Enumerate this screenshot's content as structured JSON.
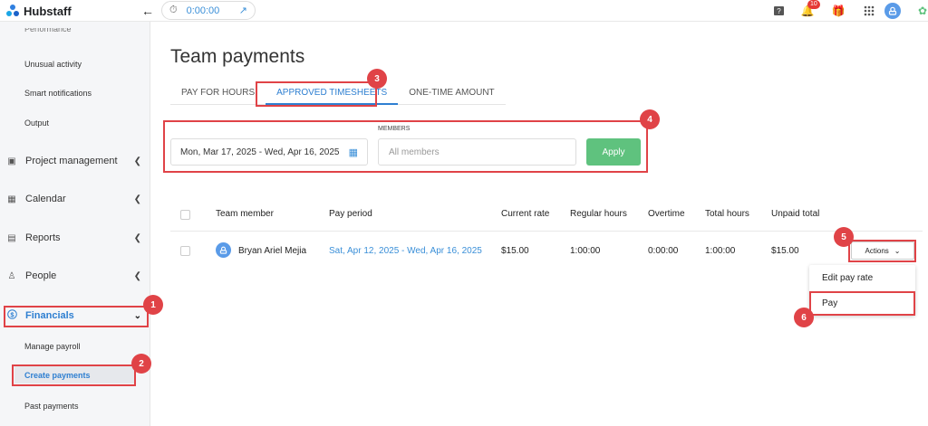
{
  "app": {
    "name": "Hubstaff",
    "timer": "0:00:00",
    "notification_count": "10"
  },
  "sidebar": {
    "partial_item": "Performance",
    "sub_items_top": [
      "Unusual activity",
      "Smart notifications",
      "Output"
    ],
    "main_items": [
      {
        "label": "Project management",
        "icon": "project-icon"
      },
      {
        "label": "Calendar",
        "icon": "calendar-icon"
      },
      {
        "label": "Reports",
        "icon": "reports-icon"
      },
      {
        "label": "People",
        "icon": "people-icon"
      },
      {
        "label": "Financials",
        "icon": "dollar-icon"
      }
    ],
    "financials_sub": [
      "Manage payroll",
      "Create payments",
      "Past payments"
    ]
  },
  "page": {
    "title": "Team payments",
    "tabs": [
      "PAY FOR HOURS",
      "APPROVED TIMESHEETS",
      "ONE-TIME AMOUNT"
    ],
    "active_tab": "APPROVED TIMESHEETS"
  },
  "filters": {
    "date_range": "Mon, Mar 17, 2025 - Wed, Apr 16, 2025",
    "members_label": "MEMBERS",
    "members_placeholder": "All members",
    "apply_label": "Apply"
  },
  "table": {
    "columns": [
      "Team member",
      "Pay period",
      "Current rate",
      "Regular hours",
      "Overtime",
      "Total hours",
      "Unpaid total"
    ],
    "rows": [
      {
        "member": "Bryan Ariel Mejia",
        "pay_period": "Sat, Apr 12, 2025 - Wed, Apr 16, 2025",
        "rate": "$15.00",
        "regular": "1:00:00",
        "overtime": "0:00:00",
        "total": "1:00:00",
        "unpaid": "$15.00"
      }
    ],
    "actions_label": "Actions",
    "actions_menu": [
      "Edit pay rate",
      "Pay"
    ]
  },
  "callouts": [
    "1",
    "2",
    "3",
    "4",
    "5",
    "6"
  ],
  "colors": {
    "accent": "#2e7fd1",
    "apply": "#5fc27e",
    "highlight": "#e04347"
  }
}
